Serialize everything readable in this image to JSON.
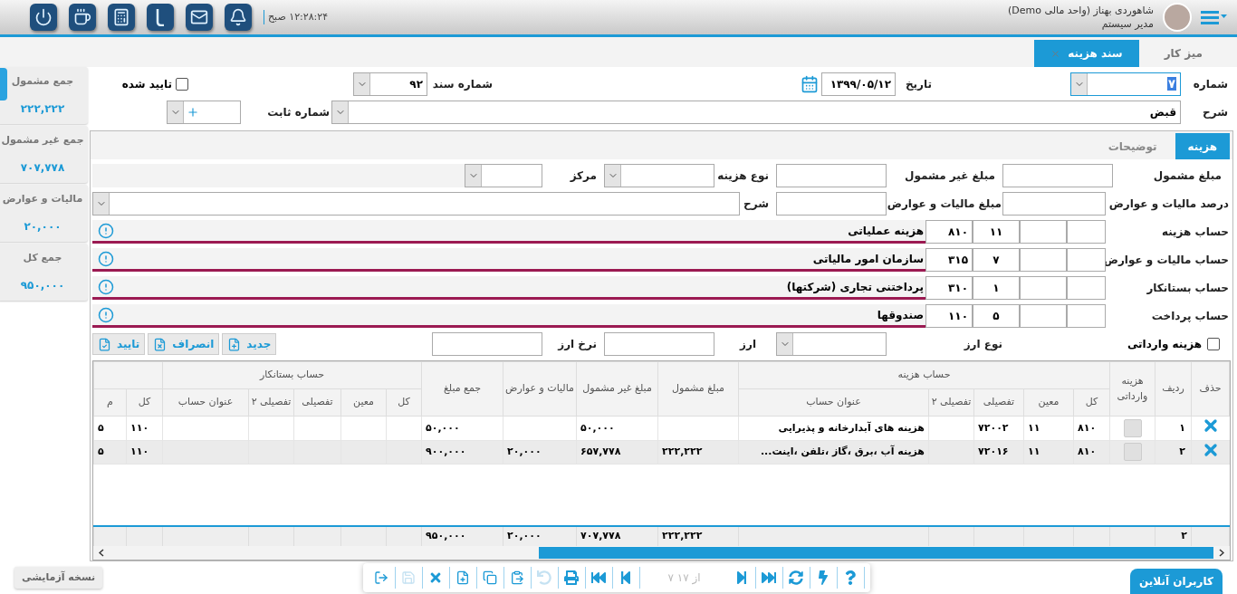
{
  "header": {
    "user_name": "شاهوردی بهناز (واحد مالی Demo)",
    "user_role": "مدیر سیستم",
    "clock": "۱۲:۲۸:۲۴ صبح"
  },
  "tabs": [
    {
      "label": "میز کار",
      "selected": false,
      "closable": false
    },
    {
      "label": "سند هزینه",
      "selected": true,
      "closable": true
    }
  ],
  "summary": [
    {
      "label": "جمع مشمول",
      "value": "۲۲۲,۲۲۲"
    },
    {
      "label": "جمع غیر مشمول",
      "value": "۷۰۷,۷۷۸"
    },
    {
      "label": "مالیات و عوارض",
      "value": "۲۰,۰۰۰"
    },
    {
      "label": "جمع کل",
      "value": "۹۵۰,۰۰۰"
    }
  ],
  "document": {
    "number": {
      "label": "شماره",
      "value": "۷"
    },
    "date": {
      "label": "تاریخ",
      "value": "۱۳۹۹/۰۵/۱۲"
    },
    "doc_no": {
      "label": "شماره سند",
      "value": "۹۲"
    },
    "approved": {
      "label": "تایید شده",
      "checked": false
    },
    "description": {
      "label": "شرح",
      "value": "قبض"
    },
    "fixed_no": {
      "label": "شماره ثابت"
    }
  },
  "panel": {
    "tabs": [
      {
        "label": "هزینه",
        "selected": true
      },
      {
        "label": "توضیحات",
        "selected": false
      }
    ],
    "taxable_label": "مبلغ مشمول",
    "non_taxable_label": "مبلغ غیر مشمول",
    "cost_type_label": "نوع هزینه",
    "center_label": "مرکز",
    "tax_percent_label": "درصد مالیات و عوارض",
    "tax_amount_label": "مبلغ مالیات و عوارض",
    "note_label": "شرح",
    "accounts": [
      {
        "label": "حساب هزینه",
        "ledger": "۸۱۰",
        "subledger": "۱۱",
        "title": "هزینه عملیاتی"
      },
      {
        "label": "حساب مالیات و عوارض",
        "ledger": "۳۱۵",
        "subledger": "۷",
        "title": "سازمان امور مالیاتی"
      },
      {
        "label": "حساب بستانکار",
        "ledger": "۳۱۰",
        "subledger": "۱",
        "title": "پرداختنی تجاری (شرکتها)"
      },
      {
        "label": "حساب پرداخت",
        "ledger": "۱۱۰",
        "subledger": "۵",
        "title": "صندوقها"
      }
    ],
    "imported": {
      "label": "هزینه وارداتی",
      "checked": false
    },
    "currency_type_label": "نوع ارز",
    "currency_label": "ارز",
    "rate_label": "نرخ ارز",
    "buttons": [
      {
        "label": "جدید",
        "kind": "new"
      },
      {
        "label": "انصراف",
        "kind": "cancel"
      },
      {
        "label": "تایید",
        "kind": "confirm"
      }
    ]
  },
  "table": {
    "header_groups": [
      {
        "label": "حذف"
      },
      {
        "label": "ردیف"
      },
      {
        "label": "هزینه وارداتی"
      },
      {
        "label": "حساب هزینه",
        "columns": [
          "کل",
          "معین",
          "تفصیلی",
          "تفصیلی ۲",
          "عنوان حساب"
        ]
      },
      {
        "label": "مبلغ مشمول"
      },
      {
        "label": "مبلغ غیر مشمول"
      },
      {
        "label": "مالیات و عوارض"
      },
      {
        "label": "جمع مبلغ"
      },
      {
        "label": "حساب بستانکار",
        "columns": [
          "کل",
          "معین",
          "تفصیلی",
          "تفصیلی ۲",
          "عنوان حساب"
        ]
      },
      {
        "columns": [
          "کل",
          "م"
        ]
      }
    ],
    "rows": [
      {
        "index": "۱",
        "imported": false,
        "selected": false,
        "ledger": "۸۱۰",
        "subledger": "۱۱",
        "detail": "۷۲۰۰۲",
        "title": "هزینه های آبدارخانه و پذیرایی",
        "non_taxable": "۵۰,۰۰۰",
        "total": "۵۰,۰۰۰",
        "column_18": "۱۱۰",
        "column_19": "۵"
      },
      {
        "index": "۲",
        "imported": false,
        "selected": true,
        "ledger": "۸۱۰",
        "subledger": "۱۱",
        "detail": "۷۲۰۱۶",
        "title": "هزینه آب ،برق ،گاز ،تلفن ،اینت...",
        "taxable": "۲۲۲,۲۲۲",
        "non_taxable": "۶۵۷,۷۷۸",
        "tax": "۲۰,۰۰۰",
        "total": "۹۰۰,۰۰۰",
        "column_18": "۱۱۰",
        "column_19": "۵"
      }
    ],
    "totals": {
      "row_count": "۲",
      "taxable": "۲۲۲,۲۲۲",
      "non_taxable": "۷۰۷,۷۷۸",
      "tax": "۲۰,۰۰۰",
      "total": "۹۵۰,۰۰۰"
    }
  },
  "toolbar": [
    {
      "kind": "exit",
      "disabled": false
    },
    {
      "kind": "save",
      "disabled": true
    },
    {
      "kind": "delete",
      "disabled": false
    },
    {
      "kind": "new",
      "disabled": false
    },
    {
      "kind": "copy",
      "disabled": false
    },
    {
      "kind": "paste",
      "disabled": false
    },
    {
      "kind": "undo",
      "disabled": true
    },
    {
      "kind": "print",
      "disabled": false
    },
    {
      "kind": "first",
      "disabled": false
    },
    {
      "kind": "prev",
      "disabled": false
    },
    {
      "kind": "pager",
      "text": "۷ از ۱۷"
    },
    {
      "kind": "next",
      "disabled": false
    },
    {
      "kind": "last",
      "disabled": false
    },
    {
      "kind": "refresh",
      "disabled": false
    },
    {
      "kind": "run",
      "disabled": false
    },
    {
      "kind": "help",
      "disabled": false
    }
  ],
  "trial_badge": "نسخه آزمایشی",
  "online_users": "کاربران آنلاین"
}
